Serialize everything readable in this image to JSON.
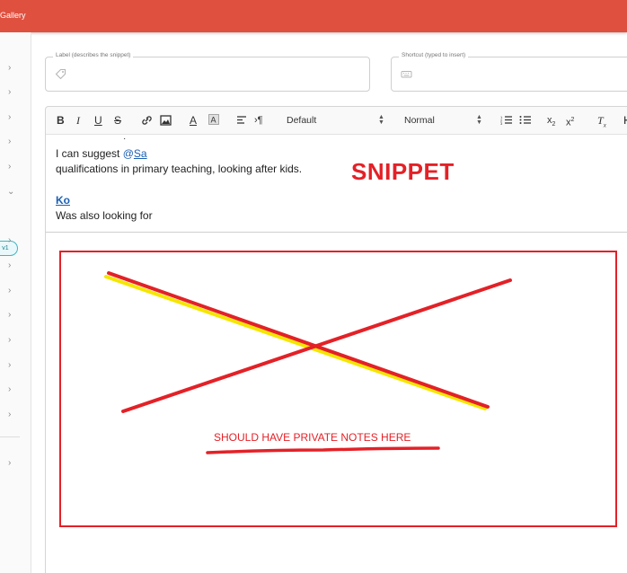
{
  "topbar": {
    "title": "Gallery"
  },
  "fields": {
    "label_field": {
      "label": "Label (describes the snippet)",
      "value": ""
    },
    "shortcut_field": {
      "label": "Shortcut (typed to insert)",
      "value": ""
    }
  },
  "toolbar": {
    "font_select": "Default",
    "size_select": "Normal"
  },
  "editor": {
    "line1_prefix": "I can suggest ",
    "line1_at": "@",
    "line1_mention": "Sa",
    "line2": "qualifications in primary teaching, looking after kids.",
    "line3_mention": "Ko",
    "line4": "Was also looking for"
  },
  "rail": {
    "pill_label": "v1"
  },
  "annotations": {
    "snippet_label": "SNIPPET",
    "notes_label": "SHOULD HAVE PRIVATE NOTES HERE",
    "color": "#e32127",
    "highlight": "#f5e600"
  },
  "colors": {
    "brand": "#e0503f",
    "accent": "#41b5c4",
    "link": "#1a5fb4"
  }
}
